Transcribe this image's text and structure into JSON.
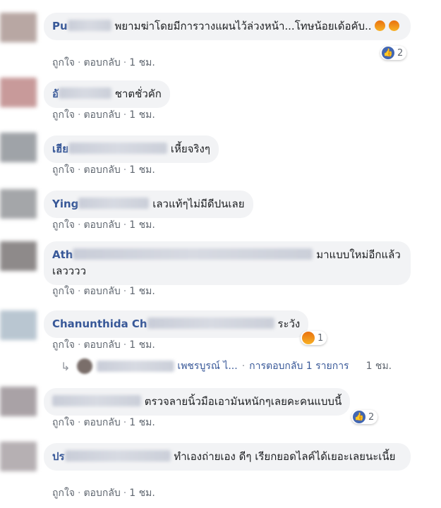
{
  "actions": {
    "like": "ถูกใจ",
    "reply": "ตอบกลับ",
    "sep": "·"
  },
  "comments": [
    {
      "author": "Pu",
      "text": "พยามฆ่าโดยมีการวางแผนไว้ล่วงหน้า...โทษน้อยเด้อคับ..",
      "time": "1 ชม.",
      "reaction_count": "2",
      "reaction_icon": "like-icon"
    },
    {
      "author": "อั",
      "text": "ชาตชั่วคัก",
      "time": "1 ชม."
    },
    {
      "author": "เฮีย",
      "text": "เหี้ยจริงๆ",
      "time": "1 ชม."
    },
    {
      "author": "Ying",
      "text": "เลวแท้ๆไม่มีดีปนเลย",
      "time": "1 ชม."
    },
    {
      "author": "Ath",
      "text": "มาแบบใหม่อีกแล้ว เลวววว",
      "time": "1 ชม."
    },
    {
      "author": "Chanunthida Ch",
      "text": "ระวัง",
      "time": "1 ชม.",
      "reaction_count": "1",
      "reaction_icon": "angry-icon"
    },
    {
      "author": "",
      "text": "ตรวจลายนิ้วมือเอามันหนักๆเลยคะคนแบบนี้",
      "time": "1 ชม.",
      "reaction_count": "2",
      "reaction_icon": "like-icon"
    },
    {
      "author": "ปร",
      "text": "ทำเองถ่ายเอง ดีๆ เรียกยอดไลค์ได้เยอะเลยนะเนี้ย",
      "time": "1 ชม."
    }
  ],
  "reply_thread": {
    "name": "เพชรบูรณ์ ไ...",
    "summary": "การตอบกลับ 1 รายการ",
    "time": "1 ชม.",
    "arrow": "↳"
  },
  "colors": {
    "name": "#385898",
    "bubble": "#f2f3f5",
    "action": "#606770",
    "like": "#4267b2"
  }
}
